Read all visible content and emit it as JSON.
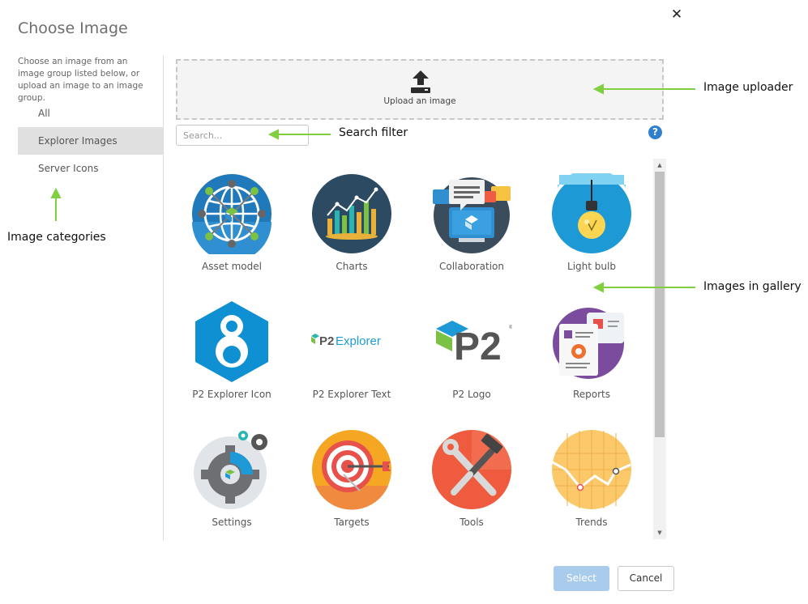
{
  "dialog": {
    "title": "Choose Image",
    "close_glyph": "✕",
    "description": "Choose an image from an image group listed below, or upload an image to an image group."
  },
  "categories": [
    {
      "label": "All",
      "selected": false
    },
    {
      "label": "Explorer Images",
      "selected": true
    },
    {
      "label": "Server Icons",
      "selected": false
    }
  ],
  "uploader": {
    "label": "Upload an image",
    "icon": "upload-icon"
  },
  "search": {
    "placeholder": "Search..."
  },
  "help": {
    "glyph": "?",
    "icon": "help-icon"
  },
  "gallery": {
    "items": [
      {
        "label": "Asset model",
        "icon": "asset-model-image"
      },
      {
        "label": "Charts",
        "icon": "charts-image"
      },
      {
        "label": "Collaboration",
        "icon": "collaboration-image"
      },
      {
        "label": "Light bulb",
        "icon": "light-bulb-image"
      },
      {
        "label": "P2 Explorer Icon",
        "icon": "p2-explorer-icon-image"
      },
      {
        "label": "P2 Explorer Text",
        "icon": "p2-explorer-text-image",
        "text": "P2Explorer"
      },
      {
        "label": "P2 Logo",
        "icon": "p2-logo-image",
        "text": "P2"
      },
      {
        "label": "Reports",
        "icon": "reports-image"
      },
      {
        "label": "Settings",
        "icon": "settings-image"
      },
      {
        "label": "Targets",
        "icon": "targets-image"
      },
      {
        "label": "Tools",
        "icon": "tools-image"
      },
      {
        "label": "Trends",
        "icon": "trends-image"
      }
    ]
  },
  "scrollbar": {
    "up_glyph": "▲",
    "down_glyph": "▼"
  },
  "buttons": {
    "select_label": "Select",
    "cancel_label": "Cancel"
  },
  "annotations": {
    "uploader": "Image uploader",
    "search": "Search filter",
    "categories": "Image categories",
    "gallery": "Images in gallery"
  },
  "colors": {
    "accent": "#2f7fcf",
    "select_button": "#a9ccec",
    "annotation_arrow": "#7fcf3f",
    "category_selected": "#e0e0e0"
  }
}
